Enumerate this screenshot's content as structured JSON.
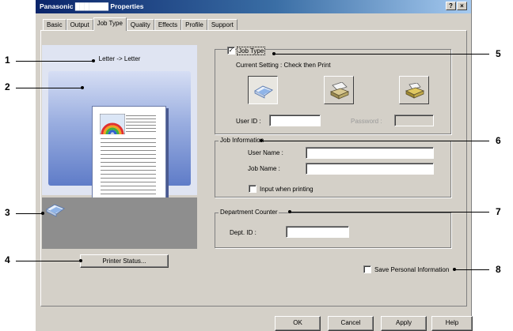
{
  "window": {
    "title": "Panasonic ███████ Properties",
    "help_btn": "?",
    "close_btn": "×"
  },
  "tabs": [
    "Basic",
    "Output",
    "Job Type",
    "Quality",
    "Effects",
    "Profile",
    "Support"
  ],
  "active_tab": "Job Type",
  "preview": {
    "paper_text": "Letter -> Letter"
  },
  "printer_status_button": "Printer Status...",
  "job_type": {
    "checkbox_label": "Job Type",
    "checked": true,
    "current_setting": "Current Setting : Check then Print",
    "user_id_label": "User ID :",
    "user_id_value": "",
    "password_label": "Password :",
    "password_value": ""
  },
  "job_information": {
    "title": "Job Information",
    "user_name_label": "User Name :",
    "user_name_value": "",
    "job_name_label": "Job Name :",
    "job_name_value": "",
    "input_when_printing_label": "Input when printing",
    "input_when_printing_checked": false
  },
  "department_counter": {
    "title": "Department Counter",
    "dept_id_label": "Dept. ID :",
    "dept_id_value": ""
  },
  "save_personal_information": {
    "label": "Save Personal Information",
    "checked": false
  },
  "buttons": {
    "ok": "OK",
    "cancel": "Cancel",
    "apply": "Apply",
    "help": "Help"
  },
  "callouts": [
    "1",
    "2",
    "3",
    "4",
    "5",
    "6",
    "7",
    "8"
  ]
}
